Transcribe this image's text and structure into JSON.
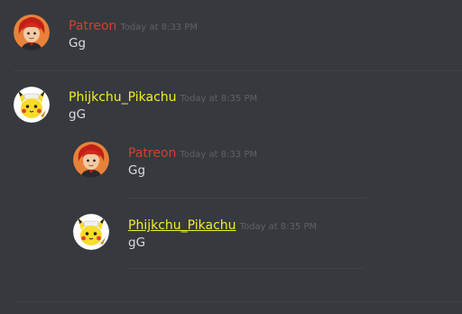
{
  "messages": [
    {
      "username": "Patreon",
      "timestamp": "Today at 8:33 PM",
      "text": "Gg",
      "avatar_icon": "red-haired-character-avatar-icon",
      "name_color": "#d2412a"
    },
    {
      "username": "Phijkchu_Pikachu",
      "timestamp": "Today at 8:35 PM",
      "text": "gG",
      "avatar_icon": "pikachu-avatar-icon",
      "name_color": "#f2ee2a"
    }
  ],
  "quoted": [
    {
      "username": "Patreon",
      "timestamp": "Today at 8:33 PM",
      "text": "Gg",
      "avatar_icon": "red-haired-character-avatar-icon"
    },
    {
      "username": "Phijkchu_Pikachu",
      "timestamp": "Today at 8:35 PM",
      "text": "gG",
      "avatar_icon": "pikachu-avatar-icon"
    }
  ],
  "colors": {
    "background": "#36393e",
    "patreon_name": "#d2412a",
    "pikachu_name": "#f2ee2a",
    "message_text": "#dcddde",
    "timestamp": "#5f6166",
    "divider": "#3f4247"
  }
}
